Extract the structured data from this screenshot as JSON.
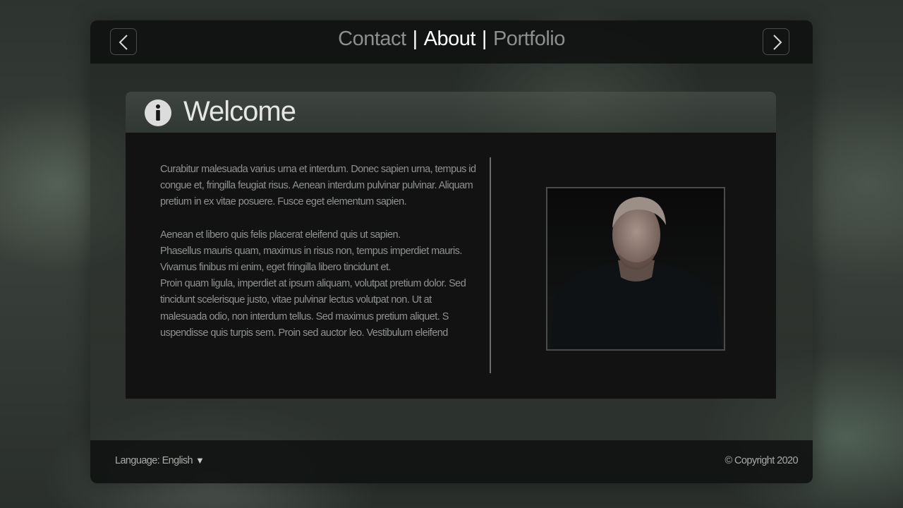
{
  "nav": {
    "prev_icon": "chevron-left-icon",
    "next_icon": "chevron-right-icon",
    "links": [
      {
        "label": "Contact",
        "active": false
      },
      {
        "label": "About",
        "active": true
      },
      {
        "label": "Portfolio",
        "active": false
      }
    ],
    "separator": "|"
  },
  "panel": {
    "icon": "info-icon",
    "title": "Welcome",
    "paragraph_1": "Curabitur malesuada varius urna et interdum. Donec sapien urna, tempus id congue et, fringilla feugiat risus. Aenean interdum pulvinar pulvinar. Aliquam pretium in ex vitae posuere. Fusce eget elementum sapien.",
    "paragraph_2_lines": [
      "Aenean et libero quis felis placerat eleifend quis ut sapien.",
      "Phasellus mauris quam, maximus in risus non, tempus imperdiet mauris. Vivamus finibus mi enim, eget fringilla libero tincidunt et.",
      "Proin quam ligula, imperdiet at ipsum aliquam, volutpat pretium dolor. Sed tincidunt scelerisque justo, vitae pulvinar lectus volutpat non. Ut at malesuada odio, non interdum tellus. Sed maximus pretium aliquet. S uspendisse quis turpis sem. Proin sed auctor leo. Vestibulum eleifend"
    ]
  },
  "footer": {
    "language_label": "Language: English",
    "dropdown_icon": "caret-down-icon",
    "copyright": "© Copyright 2020"
  },
  "colors": {
    "active_nav": "#ffffff",
    "inactive_nav": "#8c8f8d",
    "body_text": "#8f9290",
    "panel_body_bg": "#111211"
  }
}
